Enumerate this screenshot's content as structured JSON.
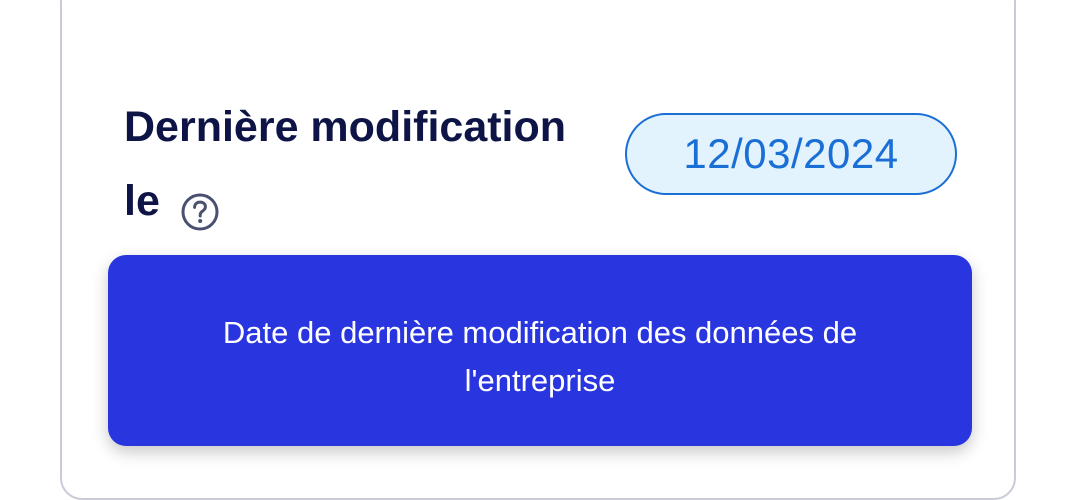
{
  "field": {
    "label": "Dernière modification le",
    "help_icon": "question-circle-icon",
    "date_value": "12/03/2024"
  },
  "tooltip": {
    "text": "Date de dernière modification des données de l'entreprise"
  },
  "colors": {
    "label": "#0e1446",
    "badge_border": "#1a6fd6",
    "badge_background": "#e3f3fd",
    "tooltip_background": "#2935de"
  }
}
